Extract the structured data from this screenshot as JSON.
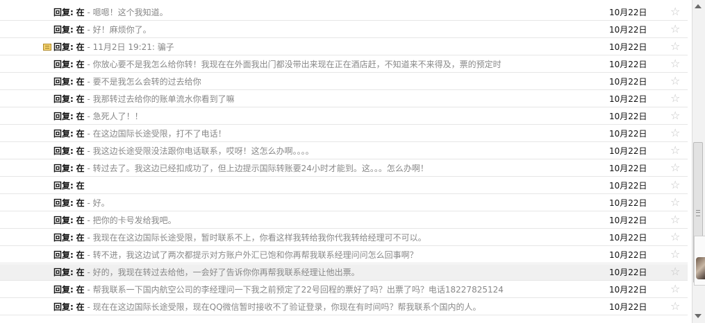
{
  "messages": [
    {
      "prefix": "回复:",
      "sender": "在",
      "separator": " - ",
      "snippet": "嗯嗯！这个我知道。",
      "date": "10月22日",
      "flag": false,
      "highlight": false
    },
    {
      "prefix": "回复:",
      "sender": "在",
      "separator": " - ",
      "snippet": "好！麻烦你了。",
      "date": "10月22日",
      "flag": false,
      "highlight": false
    },
    {
      "prefix": "回复:",
      "sender": "在",
      "separator": " - ",
      "snippet": "11月2日 19:21: 骗子",
      "date": "10月22日",
      "flag": true,
      "highlight": false
    },
    {
      "prefix": "回复:",
      "sender": "在",
      "separator": " - ",
      "snippet": "你放心要不是我怎么给你转！我现在在外面我出门都没带出来现在正在酒店赶，不知道来不来得及，票的预定时",
      "date": "10月22日",
      "flag": false,
      "highlight": false
    },
    {
      "prefix": "回复:",
      "sender": "在",
      "separator": " - ",
      "snippet": "要不是我怎么会转的过去给你",
      "date": "10月22日",
      "flag": false,
      "highlight": false
    },
    {
      "prefix": "回复:",
      "sender": "在",
      "separator": " - ",
      "snippet": "我那转过去给你的账单流水你看到了嘛",
      "date": "10月22日",
      "flag": false,
      "highlight": false
    },
    {
      "prefix": "回复:",
      "sender": "在",
      "separator": " - ",
      "snippet": "急死人了！！",
      "date": "10月22日",
      "flag": false,
      "highlight": false
    },
    {
      "prefix": "回复:",
      "sender": "在",
      "separator": " - ",
      "snippet": "在这边国际长途受限，打不了电话！",
      "date": "10月22日",
      "flag": false,
      "highlight": false
    },
    {
      "prefix": "回复:",
      "sender": "在",
      "separator": " - ",
      "snippet": "我这边长途受限没法跟你电话联系，哎呀！这怎么办啊。。。。",
      "date": "10月22日",
      "flag": false,
      "highlight": false
    },
    {
      "prefix": "回复:",
      "sender": "在",
      "separator": " - ",
      "snippet": "转过去了。我这边已经扣成功了，但上边提示国际转账要24小时才能到。这。。。怎么办啊！",
      "date": "10月22日",
      "flag": false,
      "highlight": false
    },
    {
      "prefix": "回复:",
      "sender": "在",
      "separator": "",
      "snippet": "",
      "date": "10月22日",
      "flag": false,
      "highlight": false
    },
    {
      "prefix": "回复:",
      "sender": "在",
      "separator": " - ",
      "snippet": "好。",
      "date": "10月22日",
      "flag": false,
      "highlight": false
    },
    {
      "prefix": "回复:",
      "sender": "在",
      "separator": " - ",
      "snippet": "把你的卡号发给我吧。",
      "date": "10月22日",
      "flag": false,
      "highlight": false
    },
    {
      "prefix": "回复:",
      "sender": "在",
      "separator": " - ",
      "snippet": "我现在在这边国际长途受限，暂时联系不上，你看这样我转给我你代我转给经理可不可以。",
      "date": "10月22日",
      "flag": false,
      "highlight": false
    },
    {
      "prefix": "回复:",
      "sender": "在",
      "separator": " - ",
      "snippet": "转不进，我这边试了两次都提示对方账户外汇已饱和你再帮我联系经理问问怎么回事啊？",
      "date": "10月22日",
      "flag": false,
      "highlight": false
    },
    {
      "prefix": "回复:",
      "sender": "在",
      "separator": " - ",
      "snippet": "好的，我现在转过去给他，一会好了告诉你你再帮我联系经理让他出票。",
      "date": "10月22日",
      "flag": false,
      "highlight": true
    },
    {
      "prefix": "回复:",
      "sender": "在",
      "separator": " - ",
      "snippet": "帮我联系一下国内航空公司的李经理问一下我之前预定了22号回程的票好了吗？出票了吗？电话18227825124",
      "date": "10月22日",
      "flag": false,
      "highlight": false
    },
    {
      "prefix": "回复:",
      "sender": "在",
      "separator": " - ",
      "snippet": "现在在这边国际长途受限，现在QQ微信暂时接收不了验证登录，你现在有时间吗？帮我联系个国内的人。",
      "date": "10月22日",
      "flag": false,
      "highlight": false
    }
  ],
  "icons": {
    "star": "star-icon",
    "flag": "note-flag-icon"
  },
  "colors": {
    "snippet": "#888888",
    "highlight_row": "#f0f0f0",
    "star": "#c4c4c4"
  }
}
